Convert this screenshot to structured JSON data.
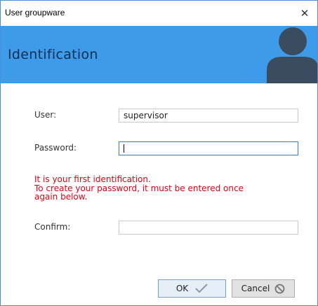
{
  "window": {
    "title": "User groupware",
    "close_symbol": "✕"
  },
  "banner": {
    "title": "Identification",
    "avatar_icon": "user-silhouette-icon",
    "background": "#3d9be9"
  },
  "form": {
    "user_label": "User:",
    "user_value": "supervisor",
    "password_label": "Password:",
    "password_value": "",
    "warning_lines": [
      "It is your first identification.",
      "To create your password, it must be entered once",
      "again below."
    ],
    "confirm_label": "Confirm:",
    "confirm_value": ""
  },
  "buttons": {
    "ok_label": "OK",
    "ok_icon": "checkmark-icon",
    "cancel_label": "Cancel",
    "cancel_icon": "prohibited-icon"
  },
  "colors": {
    "warning": "#e60012",
    "accent": "#3d9be9"
  }
}
